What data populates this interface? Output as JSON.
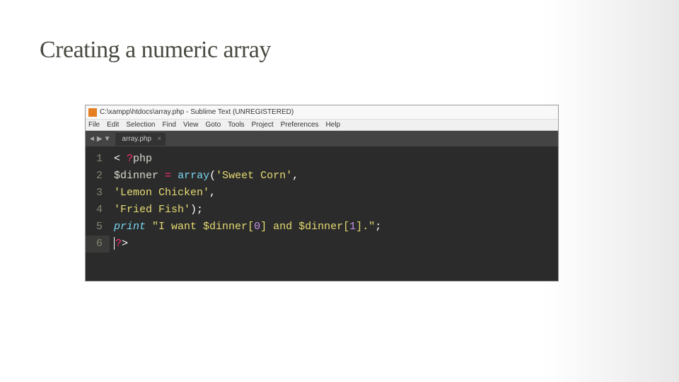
{
  "slide": {
    "title": "Creating a numeric array"
  },
  "window": {
    "title": "C:\\xampp\\htdocs\\array.php - Sublime Text (UNREGISTERED)"
  },
  "menu": {
    "items": [
      "File",
      "Edit",
      "Selection",
      "Find",
      "View",
      "Goto",
      "Tools",
      "Project",
      "Preferences",
      "Help"
    ]
  },
  "tab": {
    "name": "array.php",
    "close": "×",
    "nav_left": "◄",
    "nav_right": "▶",
    "nav_down": "▼"
  },
  "gutter": {
    "l1": "1",
    "l2": "2",
    "l3": "3",
    "l4": "4",
    "l5": "5",
    "l6": "6"
  },
  "code": {
    "l1": {
      "lt": "<",
      "q": "?",
      "php": "php"
    },
    "l2": {
      "var": "$dinner",
      "eq": "=",
      "fn": "array",
      "open": "(",
      "s1": "'Sweet Corn'",
      "comma": ","
    },
    "l3": {
      "s1": "'Lemon Chicken'",
      "comma": ","
    },
    "l4": {
      "s1": "'Fried Fish'",
      "close": ")",
      "semi": ";"
    },
    "l5": {
      "print": "print",
      "q1": "\"I want ",
      "v1": "$dinner",
      "b1": "[",
      "n1": "0",
      "b2": "]",
      "mid": " and ",
      "v2": "$dinner",
      "b3": "[",
      "n2": "1",
      "b4": "]",
      "dot": ".",
      "q2": "\"",
      "semi": ";"
    },
    "l6": {
      "q": "?",
      "gt": ">"
    }
  }
}
